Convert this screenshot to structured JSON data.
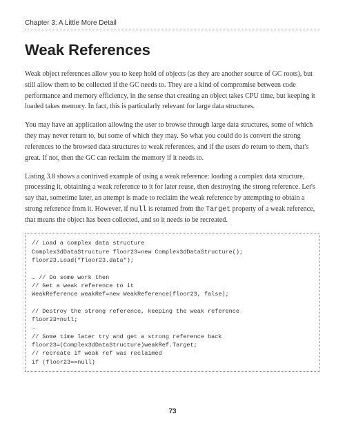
{
  "chapter": "Chapter 3: A Little More Detail",
  "section_title": "Weak References",
  "paragraphs": {
    "p1": "Weak object references allow you to keep hold of objects (as they are another source of GC roots), but still allow them to be collected if the GC needs to. They are a kind of compromise between code performance and memory efficiency, in the sense that creating an object takes CPU time, but keeping it loaded takes memory. In fact, this is particularly relevant for large data structures.",
    "p2_a": "You may have an application allowing the user to browse through large data structures, some of which they may never return to, but some of which they may. So what you could do is convert the strong references to the browsed data structures to weak references, and if the users ",
    "p2_do": "do",
    "p2_b": " return to them, that's great. If not, then the GC can reclaim the memory if it needs to.",
    "p3_a": "Listing 3.8 shows a contrived example of using a weak reference: loading a complex data structure, processing it, obtaining a weak reference to it for later reuse, then destroying the strong reference. Let's say that, sometime later, an attempt is made to reclaim the weak reference by attempting to obtain a strong reference from it. However, if ",
    "p3_null": "null",
    "p3_b": " is returned from the ",
    "p3_target": "Target",
    "p3_c": " property of a weak reference, that means the object has been collected, and so it needs to be recreated."
  },
  "code": "// Load a complex data structure\nComplex3dDataStructure floor23=new Complex3dDataStructure();\nfloor23.Load(\"floor23.data\");\n\n… // Do some work then\n// Get a weak reference to it\nWeakReference weakRef=new WeakReference(floor23, false);\n\n// Destroy the strong reference, keeping the weak reference\nfloor23=null;\n…\n// Some time later try and get a strong reference back\nfloor23=(Complex3dDataStructure)weakRef.Target;\n// recreate if weak ref was reclaimed\nif (floor23==null)",
  "page_number": "73"
}
